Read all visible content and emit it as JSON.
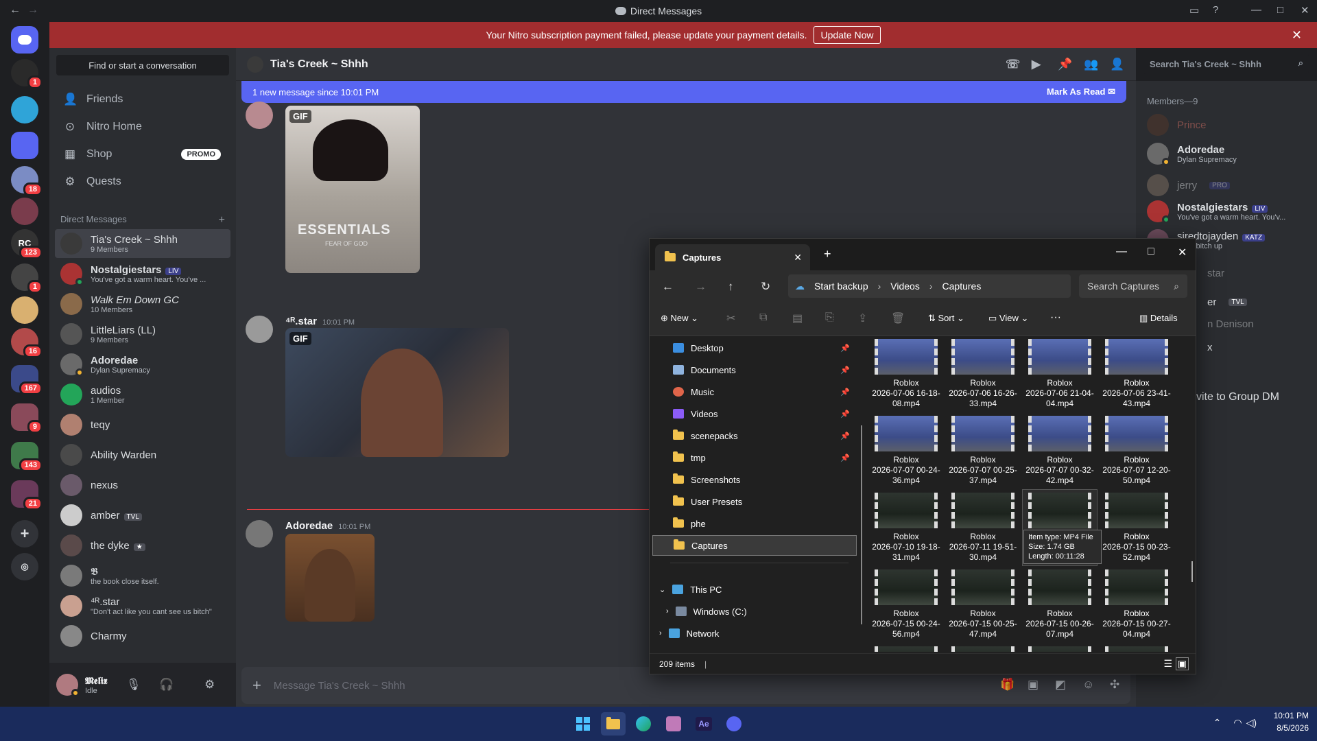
{
  "window": {
    "title": "Direct Messages",
    "back": "←",
    "forward": "→"
  },
  "colors": {
    "blurple": "#5865f2",
    "background": "#313338",
    "danger": "#f23f43",
    "online": "#23a559",
    "idle": "#f0b232"
  },
  "banner": {
    "text": "Your Nitro subscription payment failed, please update your payment details.",
    "button": "Update Now"
  },
  "servers": {
    "badges": [
      "1",
      "18",
      "123",
      "1",
      "16",
      "167",
      "9",
      "143",
      "21"
    ],
    "labels": [
      "RC"
    ]
  },
  "sidebar": {
    "find": "Find or start a conversation",
    "nav": [
      {
        "label": "Friends",
        "icon": "friends-icon"
      },
      {
        "label": "Nitro Home",
        "icon": "nitro-icon"
      },
      {
        "label": "Shop",
        "icon": "shop-icon"
      },
      {
        "label": "Quests",
        "icon": "quests-icon"
      }
    ],
    "promo": "PROMO",
    "dm_header": "Direct Messages",
    "dm_add": "+",
    "dms": [
      {
        "name": "Tia's Creek ~ Shhh",
        "sub": "9 Members"
      },
      {
        "name": "Nostalgiestars",
        "tag": "LIV",
        "sub": "You've got a warm heart. You've ..."
      },
      {
        "name": "Walk Em Down GC",
        "sub": "10 Members"
      },
      {
        "name": "LittleLiars (LL)",
        "sub": "9 Members"
      },
      {
        "name": "Adoredae",
        "sub": "Dylan Supremacy"
      },
      {
        "name": "audios",
        "sub": "1 Member"
      },
      {
        "name": "teqy",
        "sub": ""
      },
      {
        "name": "Ability Warden",
        "sub": ""
      },
      {
        "name": "nexus",
        "sub": ""
      },
      {
        "name": "amber",
        "tag": "TVL",
        "sub": ""
      },
      {
        "name": "the dyke",
        "tag": "★",
        "sub": ""
      },
      {
        "name": "𝕭",
        "sub": "the book close itself."
      },
      {
        "name": "⁴ᴿ.star",
        "sub": "\"Don't act like you cant see us bitch\""
      },
      {
        "name": "Charmy",
        "sub": ""
      }
    ]
  },
  "user": {
    "name": "𝕸𝖊𝖑𝖎𝖝",
    "status": "Idle"
  },
  "chat": {
    "title": "Tia's Creek ~ Shhh",
    "search_placeholder": "Search Tia's Creek ~ Shhh",
    "new_messages": "1 new message since 10:01 PM",
    "mark_read": "Mark As Read",
    "gif_label": "GIF",
    "messages": [
      {
        "author": "⁴ᴿ.star",
        "time": "10:01 PM"
      },
      {
        "author": "Adoredae",
        "time": "10:01 PM"
      }
    ],
    "composer_placeholder": "Message Tia's Creek ~ Shhh",
    "gif1_text": "ESSENTIALS",
    "gif1_sub": "FEAR OF GOD"
  },
  "members": {
    "title": "Members—9",
    "list": [
      {
        "name": "Prince",
        "sub": "",
        "tag": ""
      },
      {
        "name": "Adoredae",
        "sub": "Dylan Supremacy",
        "tag": ""
      },
      {
        "name": "jerry",
        "sub": "",
        "tag": "PRO"
      },
      {
        "name": "Nostalgiestars",
        "sub": "You've got a warm heart. You'v...",
        "tag": "LIV"
      },
      {
        "name": "siredtojayden",
        "sub": "eat a bitch up",
        "tag": "KATZ"
      },
      {
        "name": "star",
        "sub": "",
        "tag": ""
      },
      {
        "name": "er",
        "sub": "",
        "tag": "TVL"
      },
      {
        "name": "n Denison",
        "sub": "",
        "tag": ""
      },
      {
        "name": "x",
        "sub": "",
        "tag": ""
      }
    ],
    "invite": "vite to Group DM"
  },
  "explorer": {
    "tab": "Captures",
    "breadcrumb": [
      "Start backup",
      "Videos",
      "Captures"
    ],
    "search_placeholder": "Search Captures",
    "toolbar": {
      "new": "New",
      "sort": "Sort",
      "view": "View",
      "more": "···",
      "details": "Details"
    },
    "sidebar": [
      {
        "label": "Desktop",
        "pinned": true,
        "color": "#3b8ee0"
      },
      {
        "label": "Documents",
        "pinned": true,
        "color": "#8fb3de"
      },
      {
        "label": "Music",
        "pinned": true,
        "color": "#e0654a"
      },
      {
        "label": "Videos",
        "pinned": true,
        "color": "#8b5cf6"
      },
      {
        "label": "scenepacks",
        "pinned": true,
        "color": "#f1c24e"
      },
      {
        "label": "tmp",
        "pinned": true,
        "color": "#f1c24e"
      },
      {
        "label": "Screenshots",
        "pinned": false,
        "color": "#f1c24e"
      },
      {
        "label": "User Presets",
        "pinned": false,
        "color": "#f1c24e"
      },
      {
        "label": "phe",
        "pinned": false,
        "color": "#f1c24e"
      },
      {
        "label": "Captures",
        "pinned": false,
        "color": "#f1c24e"
      }
    ],
    "pin": "📌",
    "this_pc": "This PC",
    "drive": "Windows (C:)",
    "network": "Network",
    "files": [
      {
        "app": "Roblox",
        "name": "2026-07-06 16-18-08.mp4"
      },
      {
        "app": "Roblox",
        "name": "2026-07-06 16-26-33.mp4"
      },
      {
        "app": "Roblox",
        "name": "2026-07-06 21-04-04.mp4"
      },
      {
        "app": "Roblox",
        "name": "2026-07-06 23-41-43.mp4"
      },
      {
        "app": "Roblox",
        "name": "2026-07-07 00-24-36.mp4"
      },
      {
        "app": "Roblox",
        "name": "2026-07-07 00-25-37.mp4"
      },
      {
        "app": "Roblox",
        "name": "2026-07-07 00-32-42.mp4"
      },
      {
        "app": "Roblox",
        "name": "2026-07-07 12-20-50.mp4"
      },
      {
        "app": "Roblox",
        "name": "2026-07-10 19-18-31.mp4"
      },
      {
        "app": "Roblox",
        "name": "2026-07-11 19-51-30.mp4"
      },
      {
        "app": "",
        "name": ""
      },
      {
        "app": "Roblox",
        "name": "2026-07-15 00-23-52.mp4"
      },
      {
        "app": "Roblox",
        "name": "2026-07-15 00-24-56.mp4"
      },
      {
        "app": "Roblox",
        "name": "2026-07-15 00-25-47.mp4"
      },
      {
        "app": "Roblox",
        "name": "2026-07-15 00-26-07.mp4"
      },
      {
        "app": "Roblox",
        "name": "2026-07-15 00-27-04.mp4"
      }
    ],
    "tooltip": [
      "Item type: MP4 File",
      "Size: 1.74 GB",
      "Length: 00:11:28"
    ],
    "status": "209 items"
  },
  "taskbar": {
    "time": "10:01 PM",
    "date": "8/5/2026",
    "ae": "Ae"
  }
}
